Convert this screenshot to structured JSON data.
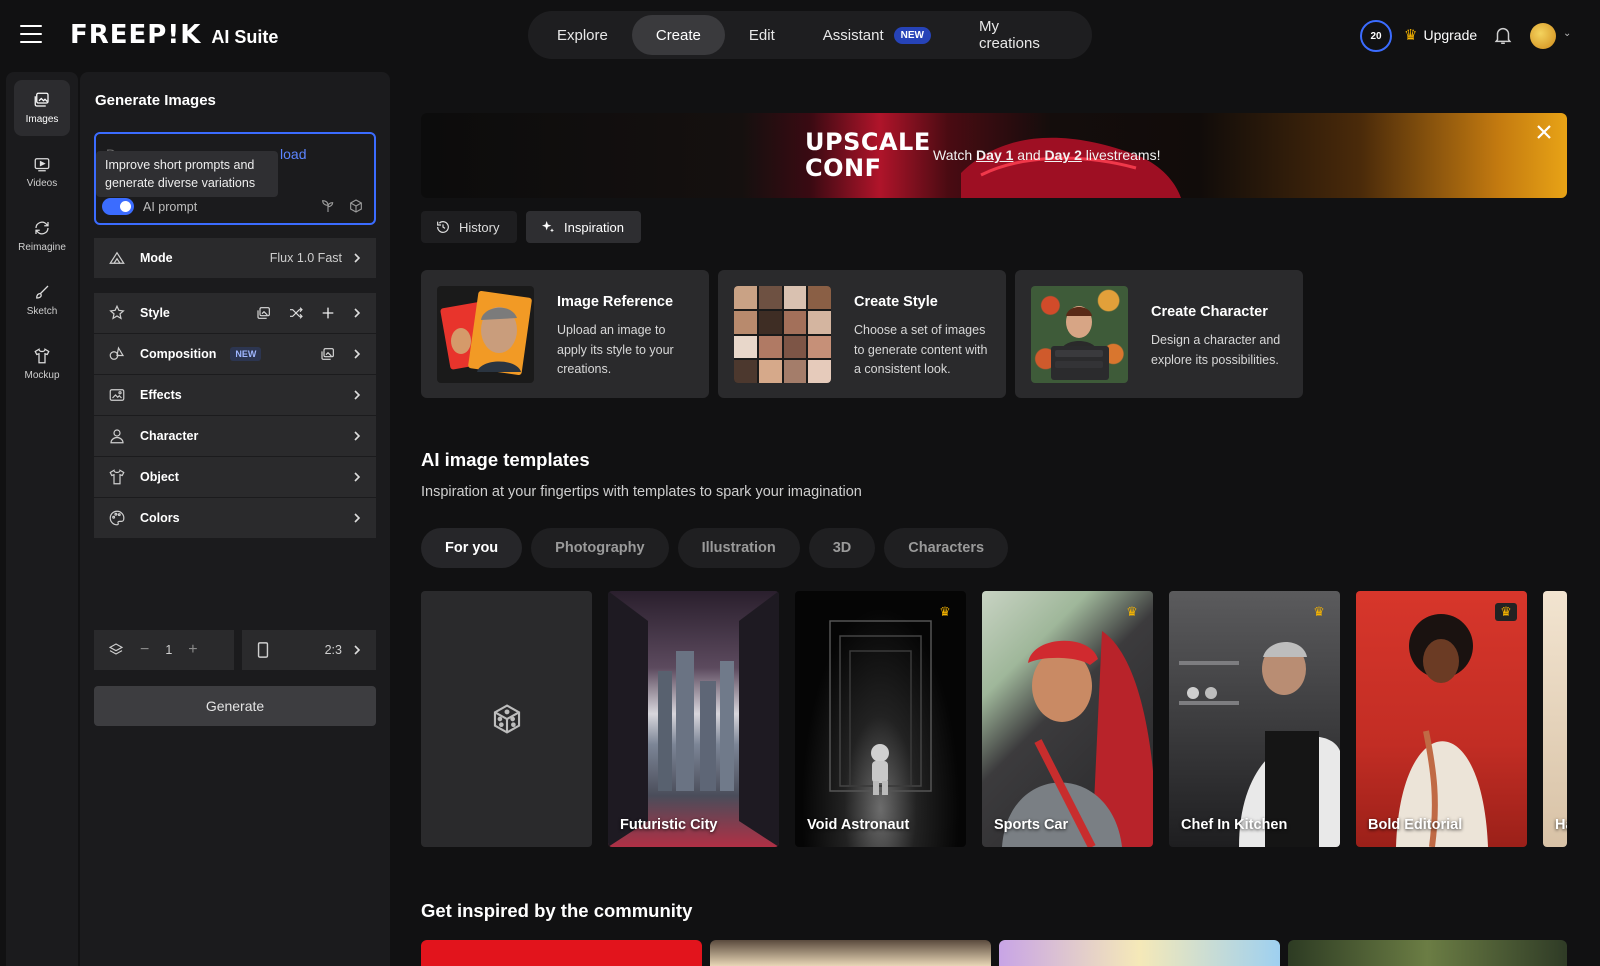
{
  "header": {
    "brand": "FREEP!K",
    "suite": "AI Suite",
    "nav": [
      {
        "label": "Explore"
      },
      {
        "label": "Create"
      },
      {
        "label": "Edit"
      },
      {
        "label": "Assistant",
        "badge": "NEW"
      },
      {
        "label": "My creations"
      }
    ],
    "active_nav": "Create",
    "credits": "20",
    "upgrade_label": "Upgrade"
  },
  "rail": {
    "items": [
      {
        "label": "Images",
        "icon": "images-icon"
      },
      {
        "label": "Videos",
        "icon": "video-icon"
      },
      {
        "label": "Reimagine",
        "icon": "reimagine-icon"
      },
      {
        "label": "Sketch",
        "icon": "brush-icon"
      },
      {
        "label": "Mockup",
        "icon": "shirt-icon"
      }
    ],
    "active": "Images"
  },
  "panel": {
    "title": "Generate Images",
    "prompt_hint_dim": "D",
    "prompt_hint_link": "load",
    "tooltip": "Improve short prompts and generate diverse variations",
    "ai_prompt_label": "AI prompt",
    "options": [
      {
        "label": "Mode",
        "value": "Flux 1.0 Fast"
      },
      {
        "label": "Style"
      },
      {
        "label": "Composition",
        "badge": "NEW"
      },
      {
        "label": "Effects"
      },
      {
        "label": "Character"
      },
      {
        "label": "Object"
      },
      {
        "label": "Colors"
      }
    ],
    "count": "1",
    "ratio": "2:3",
    "generate_label": "Generate"
  },
  "banner": {
    "title_line1": "UPSCALE",
    "title_line2": "CONF",
    "text_pre": "Watch",
    "link1": "Day 1",
    "text_mid": "and",
    "link2": "Day 2",
    "text_post": "livestreams!"
  },
  "tabs": {
    "history": "History",
    "inspiration": "Inspiration"
  },
  "cards": [
    {
      "title": "Image Reference",
      "desc": "Upload an image to apply its style to your creations."
    },
    {
      "title": "Create Style",
      "desc": "Choose a set of images to generate content with a consistent look."
    },
    {
      "title": "Create Character",
      "desc": "Design a character and explore its possibilities."
    }
  ],
  "templates": {
    "title": "AI image templates",
    "subtitle": "Inspiration at your fingertips with templates to spark your imagination",
    "filters": [
      "For you",
      "Photography",
      "Illustration",
      "3D",
      "Characters"
    ],
    "active_filter": "For you",
    "items": [
      {
        "name": "Futuristic City",
        "premium": false
      },
      {
        "name": "Void Astronaut",
        "premium": true
      },
      {
        "name": "Sports Car",
        "premium": true
      },
      {
        "name": "Chef In Kitchen",
        "premium": true
      },
      {
        "name": "Bold Editorial",
        "premium": true
      },
      {
        "name": "Ha",
        "premium": false
      }
    ]
  },
  "community": {
    "title": "Get inspired by the community"
  },
  "colors": {
    "accent": "#3b6cff",
    "premium": "#f7b500",
    "panel": "#1b1b1d",
    "option": "#2a2a2c"
  }
}
